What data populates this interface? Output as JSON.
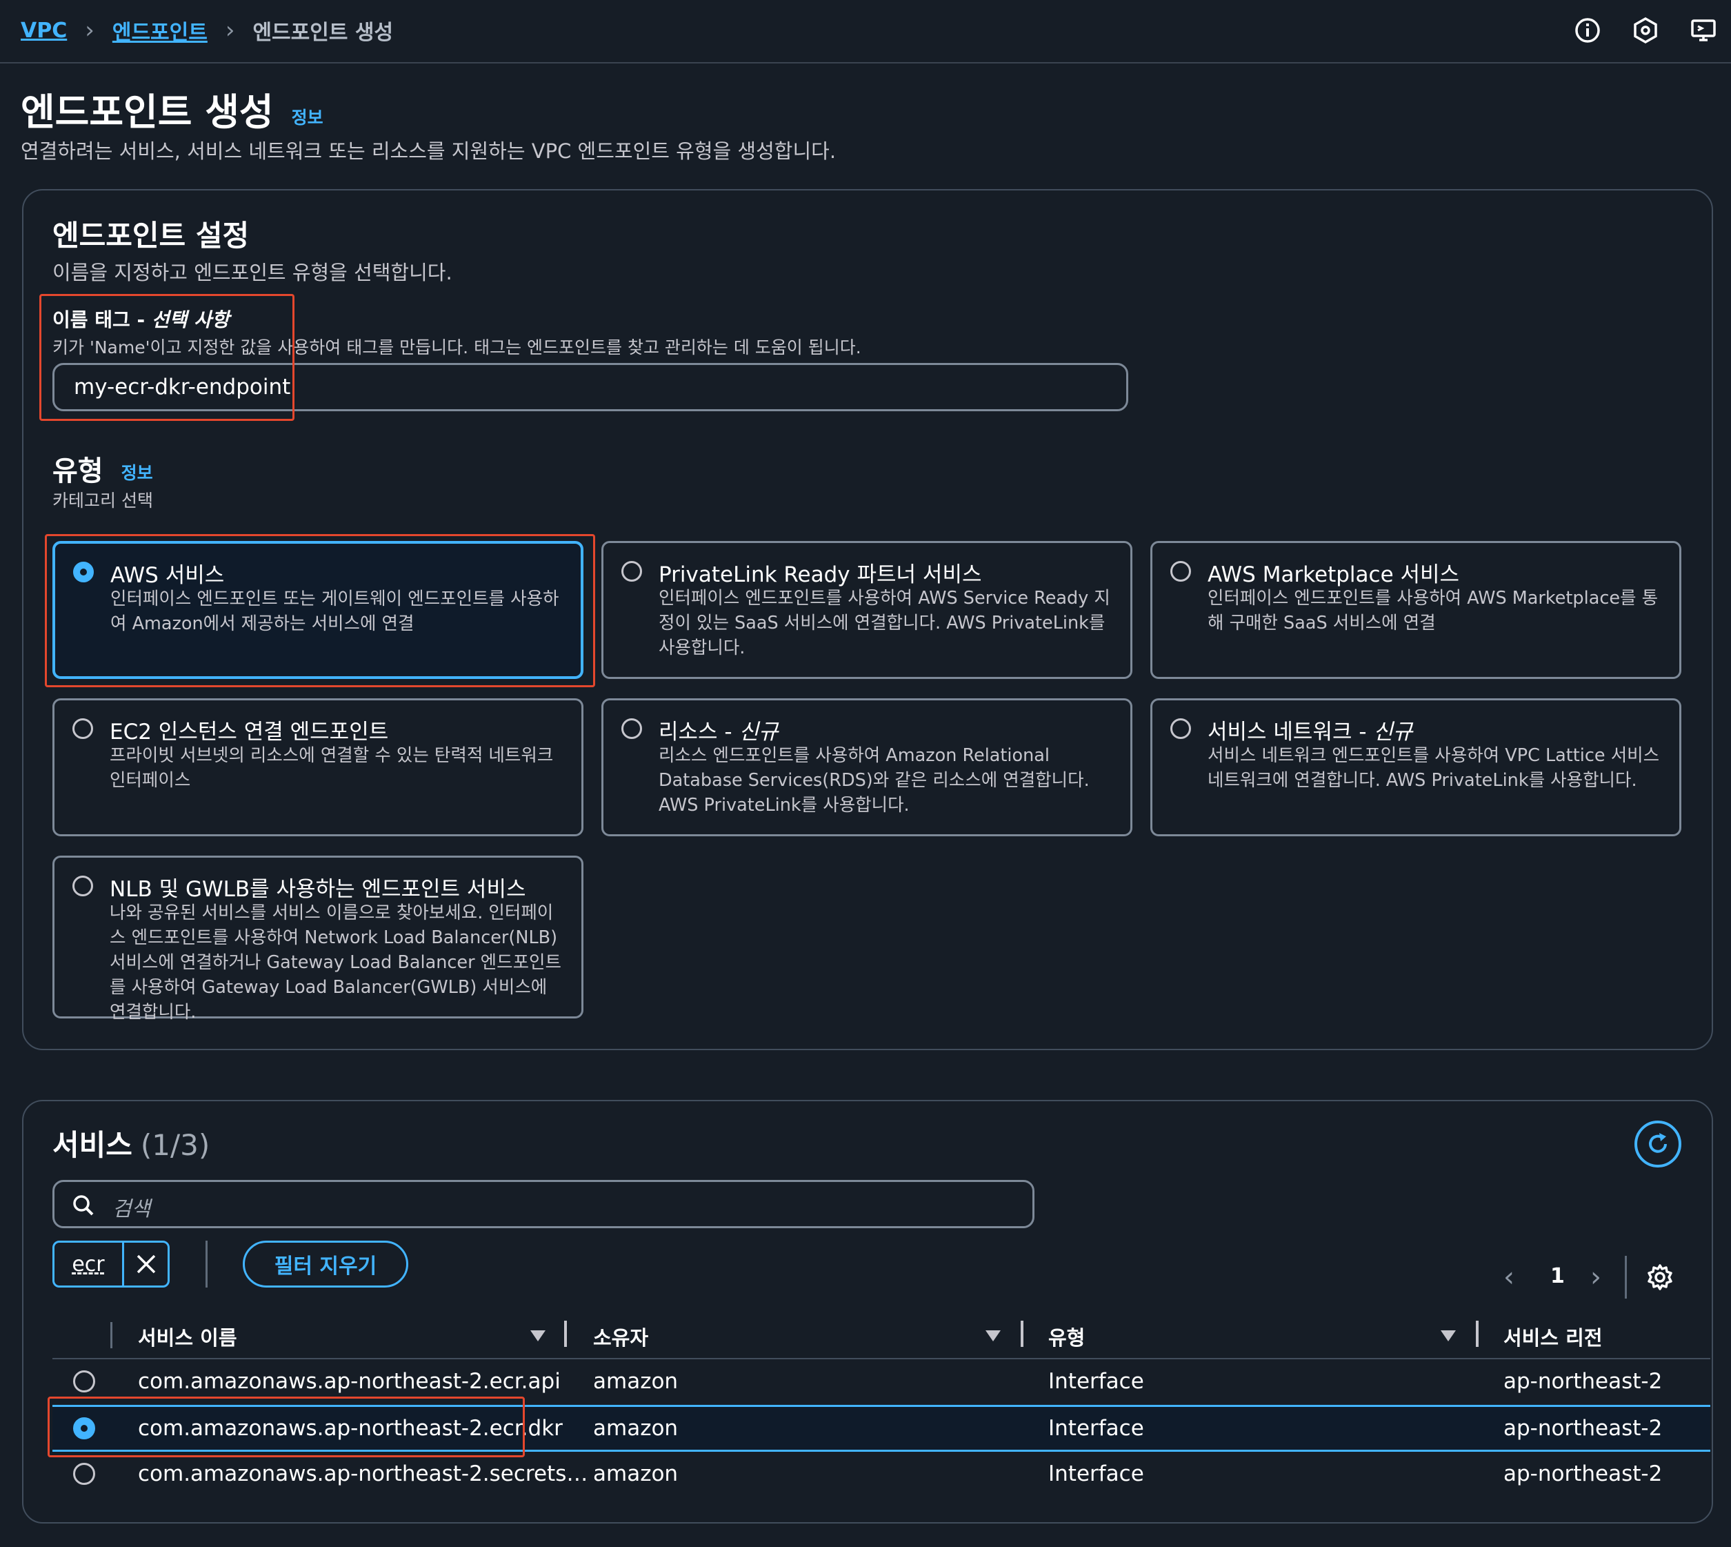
{
  "breadcrumb": {
    "items": [
      "VPC",
      "엔드포인트",
      "엔드포인트 생성"
    ]
  },
  "topbar_icons": [
    "info-icon",
    "settings-hex-icon",
    "monitor-icon"
  ],
  "page": {
    "title": "엔드포인트 생성",
    "info_link": "정보",
    "description": "연결하려는 서비스, 서비스 네트워크 또는 리소스를 지원하는 VPC 엔드포인트 유형을 생성합니다."
  },
  "settings": {
    "title": "엔드포인트 설정",
    "description": "이름을 지정하고 엔드포인트 유형을 선택합니다.",
    "name_tag_label": "이름 태그 - ",
    "name_tag_optional": "선택 사항",
    "name_tag_help": "키가 'Name'이고 지정한 값을 사용하여 태그를 만듭니다. 태그는 엔드포인트를 찾고 관리하는 데 도움이 됩니다.",
    "name_tag_value": "my-ecr-dkr-endpoint",
    "type_label": "유형",
    "type_info": "정보",
    "type_help": "카테고리 선택"
  },
  "tiles": [
    {
      "title": "AWS 서비스",
      "suffix": "",
      "desc": "인터페이스 엔드포인트 또는 게이트웨이 엔드포인트를 사용하여 Amazon에서 제공하는 서비스에 연결",
      "selected": true
    },
    {
      "title": "PrivateLink Ready 파트너 서비스",
      "suffix": "",
      "desc": "인터페이스 엔드포인트를 사용하여 AWS Service Ready 지정이 있는 SaaS 서비스에 연결합니다. AWS PrivateLink를 사용합니다.",
      "selected": false
    },
    {
      "title": "AWS Marketplace 서비스",
      "suffix": "",
      "desc": "인터페이스 엔드포인트를 사용하여 AWS Marketplace를 통해 구매한 SaaS 서비스에 연결",
      "selected": false
    },
    {
      "title": "EC2 인스턴스 연결 엔드포인트",
      "suffix": "",
      "desc": "프라이빗 서브넷의 리소스에 연결할 수 있는 탄력적 네트워크 인터페이스",
      "selected": false
    },
    {
      "title": "리소스 - ",
      "suffix": "신규",
      "desc": "리소스 엔드포인트를 사용하여 Amazon Relational Database Services(RDS)와 같은 리소스에 연결합니다. AWS PrivateLink를 사용합니다.",
      "selected": false
    },
    {
      "title": "서비스 네트워크 - ",
      "suffix": "신규",
      "desc": "서비스 네트워크 엔드포인트를 사용하여 VPC Lattice 서비스 네트워크에 연결합니다. AWS PrivateLink를 사용합니다.",
      "selected": false
    },
    {
      "title": "NLB 및 GWLB를 사용하는 엔드포인트 서비스",
      "suffix": "",
      "desc": "나와 공유된 서비스를 서비스 이름으로 찾아보세요. 인터페이스 엔드포인트를 사용하여 Network Load Balancer(NLB) 서비스에 연결하거나 Gateway Load Balancer 엔드포인트를 사용하여 Gateway Load Balancer(GWLB) 서비스에 연결합니다.",
      "selected": false
    }
  ],
  "services": {
    "title": "서비스",
    "count": "(1/3)",
    "search_placeholder": "검색",
    "filter_token": "ecr",
    "clear_filter_label": "필터 지우기",
    "page_number": "1",
    "columns": [
      "서비스 이름",
      "소유자",
      "유형",
      "서비스 리전"
    ],
    "rows": [
      {
        "name": "com.amazonaws.ap-northeast-2.ecr.api",
        "owner": "amazon",
        "type": "Interface",
        "region": "ap-northeast-2",
        "selected": false
      },
      {
        "name": "com.amazonaws.ap-northeast-2.ecr.dkr",
        "owner": "amazon",
        "type": "Interface",
        "region": "ap-northeast-2",
        "selected": true
      },
      {
        "name": "com.amazonaws.ap-northeast-2.secrets…",
        "owner": "amazon",
        "type": "Interface",
        "region": "ap-northeast-2",
        "selected": false
      }
    ]
  },
  "colors": {
    "background": "#161d26",
    "accent": "#42b4ff",
    "highlight_red": "#e4472d",
    "border": "#7d8998"
  }
}
